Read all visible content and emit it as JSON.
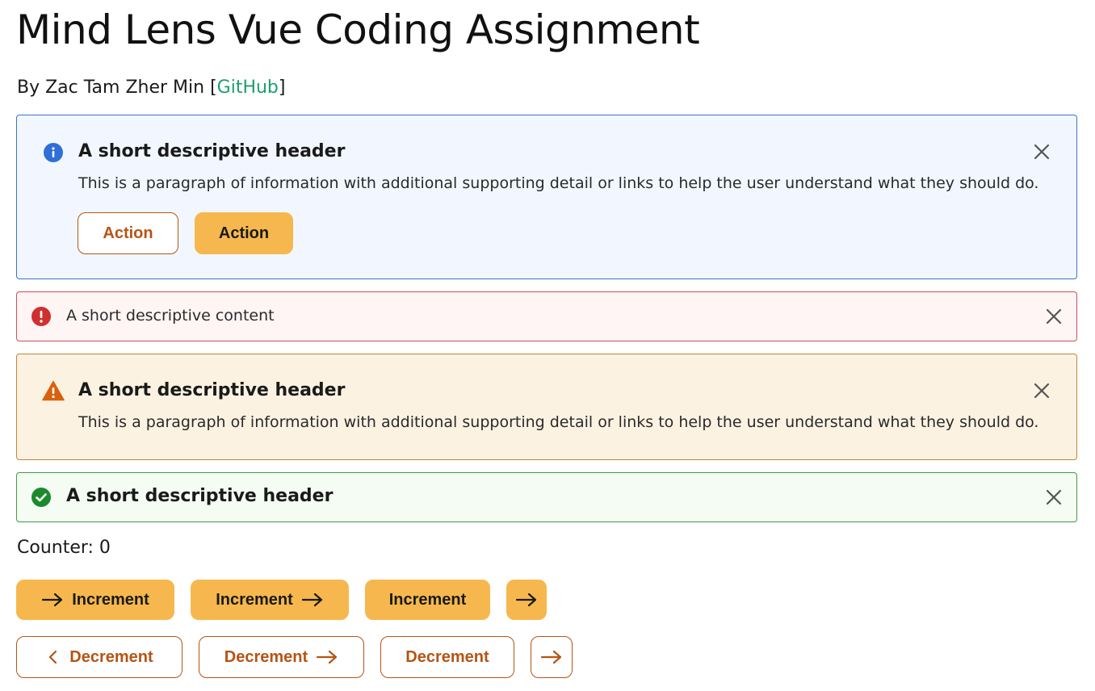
{
  "page": {
    "title": "Mind Lens Vue Coding Assignment",
    "byline_prefix": "By Zac Tam Zher Min [",
    "github_link": "GitHub",
    "byline_suffix": "]"
  },
  "alerts": {
    "info": {
      "title": "A short descriptive header",
      "body": "This is a paragraph of information with additional supporting detail or links to help the user understand what they should do.",
      "action_secondary": "Action",
      "action_primary": "Action",
      "icon": "info-icon",
      "color": "#2f6fd6"
    },
    "error": {
      "content": "A short descriptive content",
      "icon": "error-icon",
      "color": "#d0302f"
    },
    "warning": {
      "title": "A short descriptive header",
      "body": "This is a paragraph of information with additional supporting detail or links to help the user understand what they should do.",
      "icon": "warning-icon",
      "color": "#d9610e"
    },
    "success": {
      "title": "A short descriptive header",
      "icon": "check-circle-icon",
      "color": "#1c8a2c"
    }
  },
  "counter": {
    "label": "Counter: 0"
  },
  "buttons": {
    "increment": [
      "Increment",
      "Increment",
      "Increment"
    ],
    "decrement": [
      "Decrement",
      "Decrement",
      "Decrement"
    ]
  },
  "colors": {
    "primary_fill": "#f6b84e",
    "outline_accent": "#b65413",
    "link": "#1aa06b"
  }
}
